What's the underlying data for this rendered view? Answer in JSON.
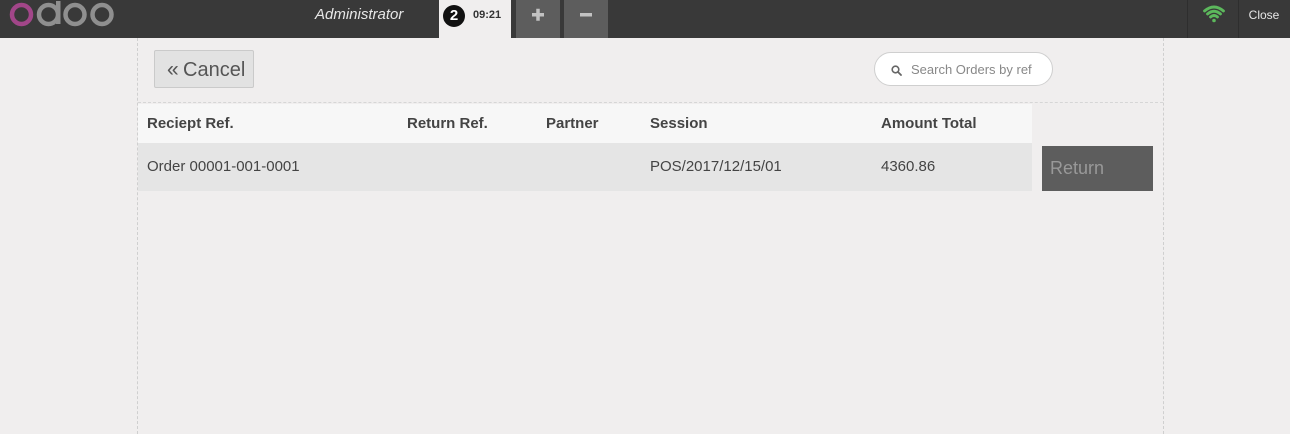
{
  "header": {
    "logo_text": "odoo",
    "user_name": "Administrator",
    "order": {
      "number": "2",
      "time": "09:21"
    },
    "add_order_icon": "plus-icon",
    "remove_order_icon": "minus-icon",
    "connection_icon": "wifi-icon",
    "close_label": "Close"
  },
  "toolbar": {
    "cancel_label": "Cancel",
    "cancel_icon": "double-chevron-left-icon",
    "search_placeholder": "Search Orders by ref",
    "search_icon": "search-icon"
  },
  "table": {
    "columns": [
      "Reciept Ref.",
      "Return Ref.",
      "Partner",
      "Session",
      "Amount Total"
    ],
    "rows": [
      {
        "receipt_ref": "Order 00001-001-0001",
        "return_ref": "",
        "partner": "",
        "session": "POS/2017/12/15/01",
        "amount_total": "4360.86",
        "action": "Return"
      }
    ]
  },
  "colors": {
    "topbar": "#393939",
    "logo_accent": "#a24689",
    "wifi": "#5cb85c",
    "background": "#f0eeee"
  }
}
